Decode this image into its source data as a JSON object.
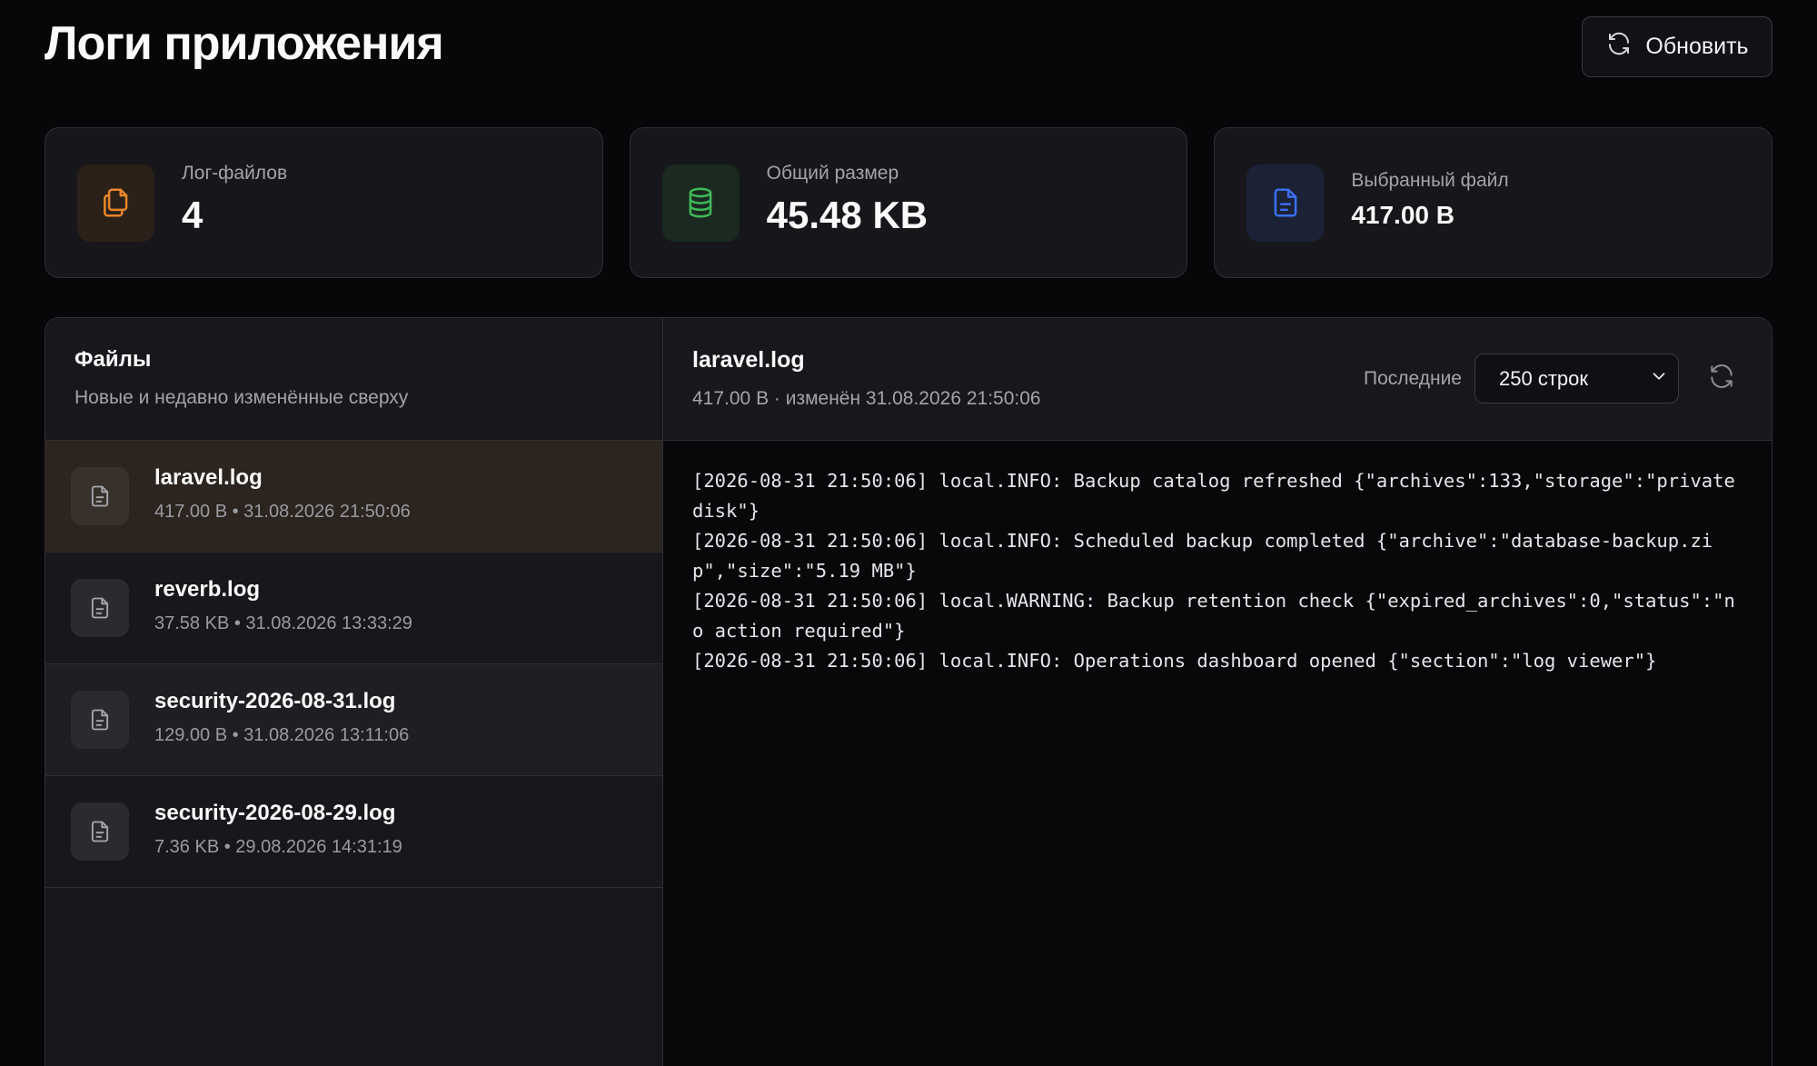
{
  "header": {
    "title": "Логи приложения",
    "refresh_label": "Обновить"
  },
  "stats": [
    {
      "label": "Лог-файлов",
      "value": "4",
      "icon": "files-icon",
      "color": "#e8862a"
    },
    {
      "label": "Общий размер",
      "value": "45.48 KB",
      "icon": "database-icon",
      "color": "#3fb859"
    },
    {
      "label": "Выбранный файл",
      "value": "417.00 B",
      "icon": "file-text-icon",
      "color": "#3b6ff0"
    }
  ],
  "files_pane": {
    "title": "Файлы",
    "subtitle": "Новые и недавно изменённые сверху",
    "items": [
      {
        "name": "laravel.log",
        "info": "417.00 B • 31.08.2026 21:50:06",
        "selected": true
      },
      {
        "name": "reverb.log",
        "info": "37.58 KB • 31.08.2026 13:33:29"
      },
      {
        "name": "security-2026-08-31.log",
        "info": "129.00 B • 31.08.2026 13:11:06"
      },
      {
        "name": "security-2026-08-29.log",
        "info": "7.36 KB • 29.08.2026 14:31:19"
      }
    ]
  },
  "viewer": {
    "file_name": "laravel.log",
    "file_info": "417.00 B · изменён 31.08.2026 21:50:06",
    "lines_label": "Последние",
    "lines_selected": "250 строк",
    "log_lines": [
      "[2026-08-31 21:50:06] local.INFO: Backup catalog refreshed {\"archives\":133,\"storage\":\"private disk\"}",
      "[2026-08-31 21:50:06] local.INFO: Scheduled backup completed {\"archive\":\"database-backup.zip\",\"size\":\"5.19 MB\"}",
      "[2026-08-31 21:50:06] local.WARNING: Backup retention check {\"expired_archives\":0,\"status\":\"no action required\"}",
      "[2026-08-31 21:50:06] local.INFO: Operations dashboard opened {\"section\":\"log viewer\"}"
    ]
  },
  "colors": {
    "accent_orange": "#e8862a",
    "accent_green": "#3fb859",
    "accent_blue": "#3b6ff0",
    "background": "#07070a",
    "selected_row": "#2b241f"
  }
}
